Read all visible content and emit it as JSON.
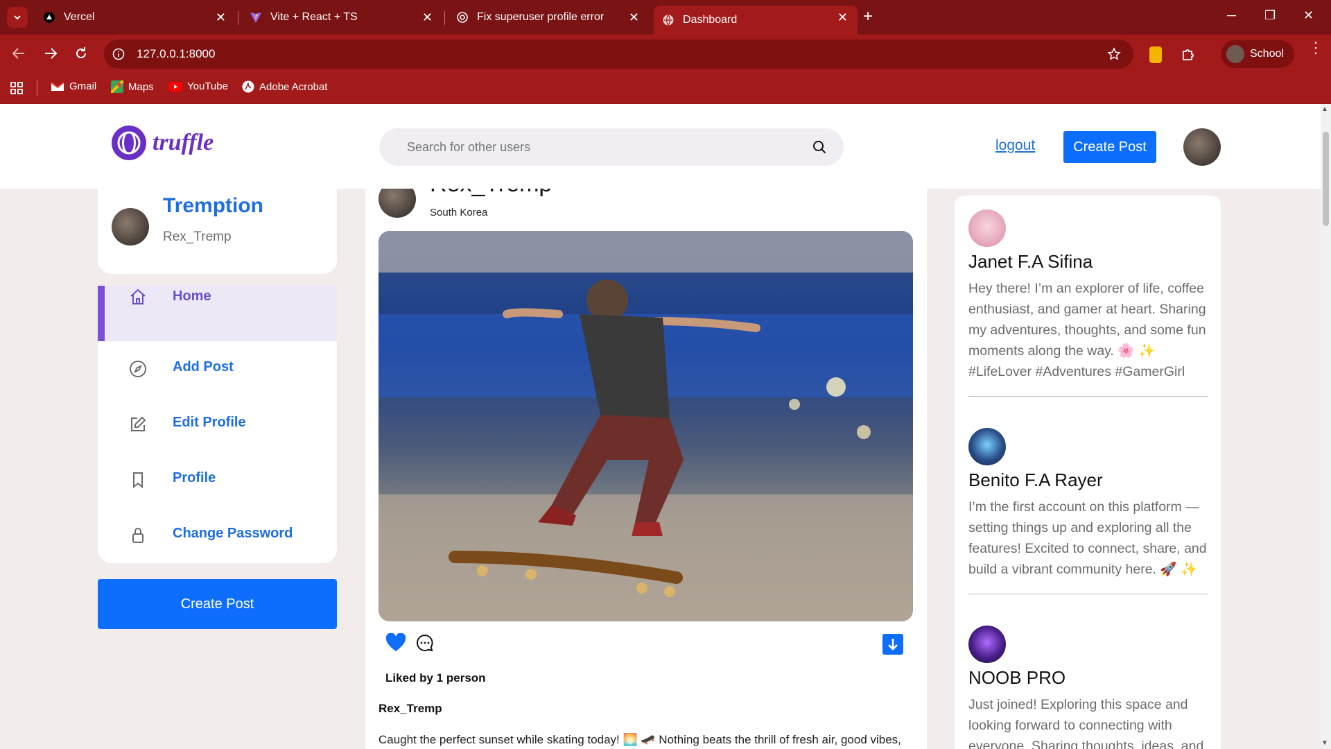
{
  "browser": {
    "tabs": [
      {
        "title": "Vercel",
        "icon": "vercel-icon"
      },
      {
        "title": "Vite + React + TS",
        "icon": "vite-icon"
      },
      {
        "title": "Fix superuser profile error",
        "icon": "chatgpt-icon"
      },
      {
        "title": "Dashboard",
        "icon": "globe-icon",
        "active": true
      }
    ],
    "url": "127.0.0.1:8000",
    "profile_name": "School",
    "bookmarks": [
      {
        "label": "Gmail",
        "icon": "gmail-icon"
      },
      {
        "label": "Maps",
        "icon": "maps-icon"
      },
      {
        "label": "YouTube",
        "icon": "youtube-icon"
      },
      {
        "label": "Adobe Acrobat",
        "icon": "acrobat-icon"
      }
    ],
    "colors": {
      "frame": "#a31a1a",
      "tabstrip": "#7a1313"
    }
  },
  "header": {
    "logo_text": "truffle",
    "search_placeholder": "Search for other users",
    "logout_label": "logout",
    "create_post_label": "Create Post",
    "accent": "#0d6efd",
    "logo_color": "#6a2fc4"
  },
  "profile_card": {
    "display_name": "Tremption",
    "username": "Rex_Tremp"
  },
  "sidebar": {
    "items": [
      {
        "label": "Home",
        "icon": "home-icon",
        "active": true
      },
      {
        "label": "Add Post",
        "icon": "compass-icon"
      },
      {
        "label": "Edit Profile",
        "icon": "edit-icon"
      },
      {
        "label": "Profile",
        "icon": "bookmark-icon"
      },
      {
        "label": "Change Password",
        "icon": "lock-icon"
      }
    ],
    "create_post_label": "Create Post"
  },
  "post": {
    "author": "Rex_Tremp",
    "location": "South Korea",
    "likes_text": "Liked by 1 person",
    "caption_author": "Rex_Tremp",
    "caption": "Caught the perfect sunset while skating today! 🌅 🛹 Nothing beats the thrill of fresh air, good vibes,"
  },
  "suggestions": [
    {
      "name": "Janet F.A Sifina",
      "bio": "Hey there! I’m an explorer of life, coffee enthusiast, and gamer at heart. Sharing my adventures, thoughts, and some fun moments along the way. 🌸 ✨ #LifeLover #Adventures #GamerGirl"
    },
    {
      "name": "Benito F.A Rayer",
      "bio": "I’m the first account on this platform — setting things up and exploring all the features! Excited to connect, share, and build a vibrant community here. 🚀 ✨"
    },
    {
      "name": "NOOB PRO",
      "bio": "Just joined! Exploring this space and looking forward to connecting with everyone. Sharing thoughts, ideas, and"
    }
  ]
}
